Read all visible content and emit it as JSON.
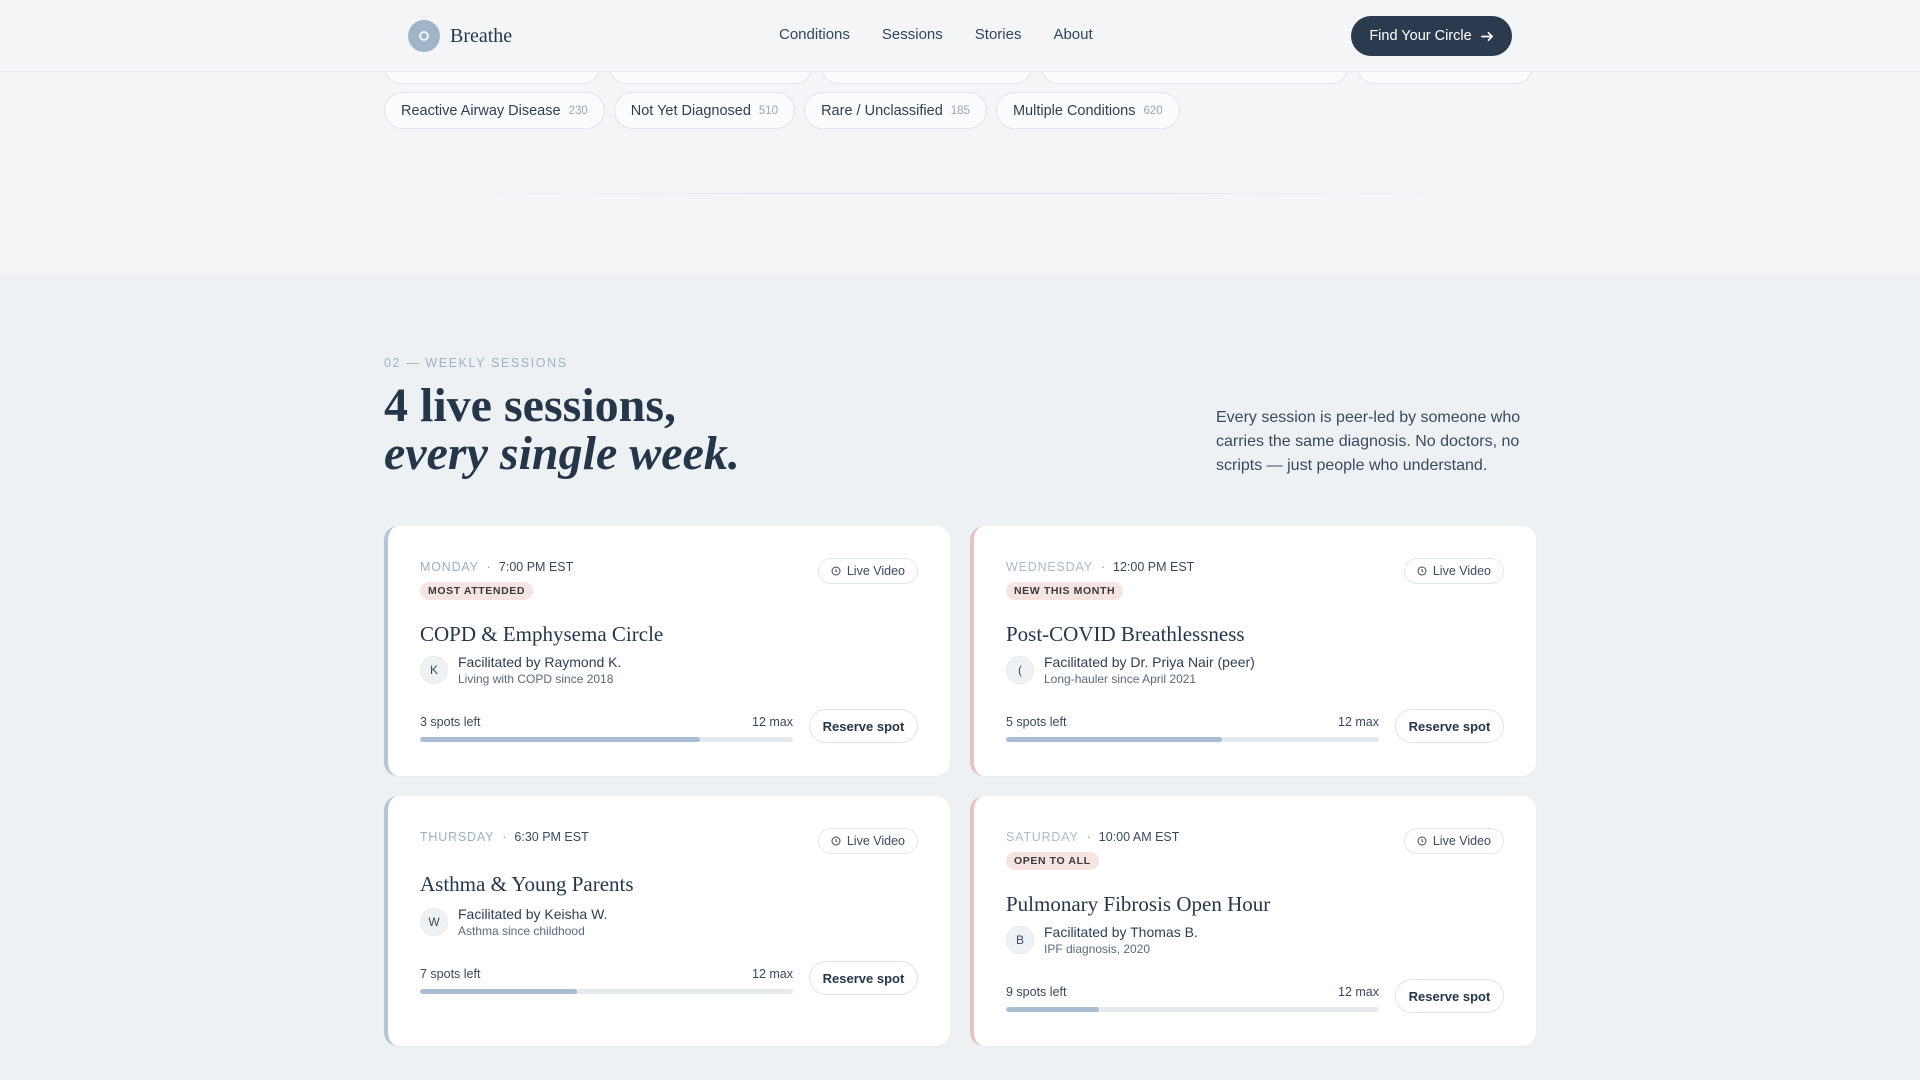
{
  "header": {
    "brand": "Breathe",
    "nav": [
      "Conditions",
      "Sessions",
      "Stories",
      "About"
    ],
    "cta": "Find Your Circle"
  },
  "chips_top_partial": [
    "",
    "",
    "",
    "",
    ""
  ],
  "chips": [
    {
      "label": "Reactive Airway Disease",
      "count": "230"
    },
    {
      "label": "Not Yet Diagnosed",
      "count": "510"
    },
    {
      "label": "Rare / Unclassified",
      "count": "185"
    },
    {
      "label": "Multiple Conditions",
      "count": "620"
    }
  ],
  "section": {
    "eyebrow": "02 — WEEKLY SESSIONS",
    "headline_line1": "4 live sessions,",
    "headline_line2": "every single week.",
    "intro": "Every session is peer-led by someone who carries the same diagnosis. No doctors, no scripts — just people who understand."
  },
  "sessions": [
    {
      "day": "MONDAY",
      "time": "7:00 PM EST",
      "badge": "MOST ATTENDED",
      "format": "Live Video",
      "title": "COPD & Emphysema Circle",
      "initial": "K",
      "facilitator": "Facilitated by Raymond K.",
      "bio": "Living with COPD since 2018",
      "spots": "3 spots left",
      "max": "12 max",
      "fill_fraction": 0.75,
      "action": "Reserve spot"
    },
    {
      "day": "WEDNESDAY",
      "time": "12:00 PM EST",
      "badge": "NEW THIS MONTH",
      "format": "Live Video",
      "title": "Post-COVID Breathlessness",
      "initial": "(",
      "facilitator": "Facilitated by Dr. Priya Nair (peer)",
      "bio": "Long-hauler since April 2021",
      "spots": "5 spots left",
      "max": "12 max",
      "fill_fraction": 0.58,
      "action": "Reserve spot"
    },
    {
      "day": "THURSDAY",
      "time": "6:30 PM EST",
      "badge": "",
      "format": "Live Video",
      "title": "Asthma & Young Parents",
      "initial": "W",
      "facilitator": "Facilitated by Keisha W.",
      "bio": "Asthma since childhood",
      "spots": "7 spots left",
      "max": "12 max",
      "fill_fraction": 0.42,
      "action": "Reserve spot"
    },
    {
      "day": "SATURDAY",
      "time": "10:00 AM EST",
      "badge": "OPEN TO ALL",
      "format": "Live Video",
      "title": "Pulmonary Fibrosis Open Hour",
      "initial": "B",
      "facilitator": "Facilitated by Thomas B.",
      "bio": "IPF diagnosis, 2020",
      "spots": "9 spots left",
      "max": "12 max",
      "fill_fraction": 0.25,
      "action": "Reserve spot"
    }
  ]
}
